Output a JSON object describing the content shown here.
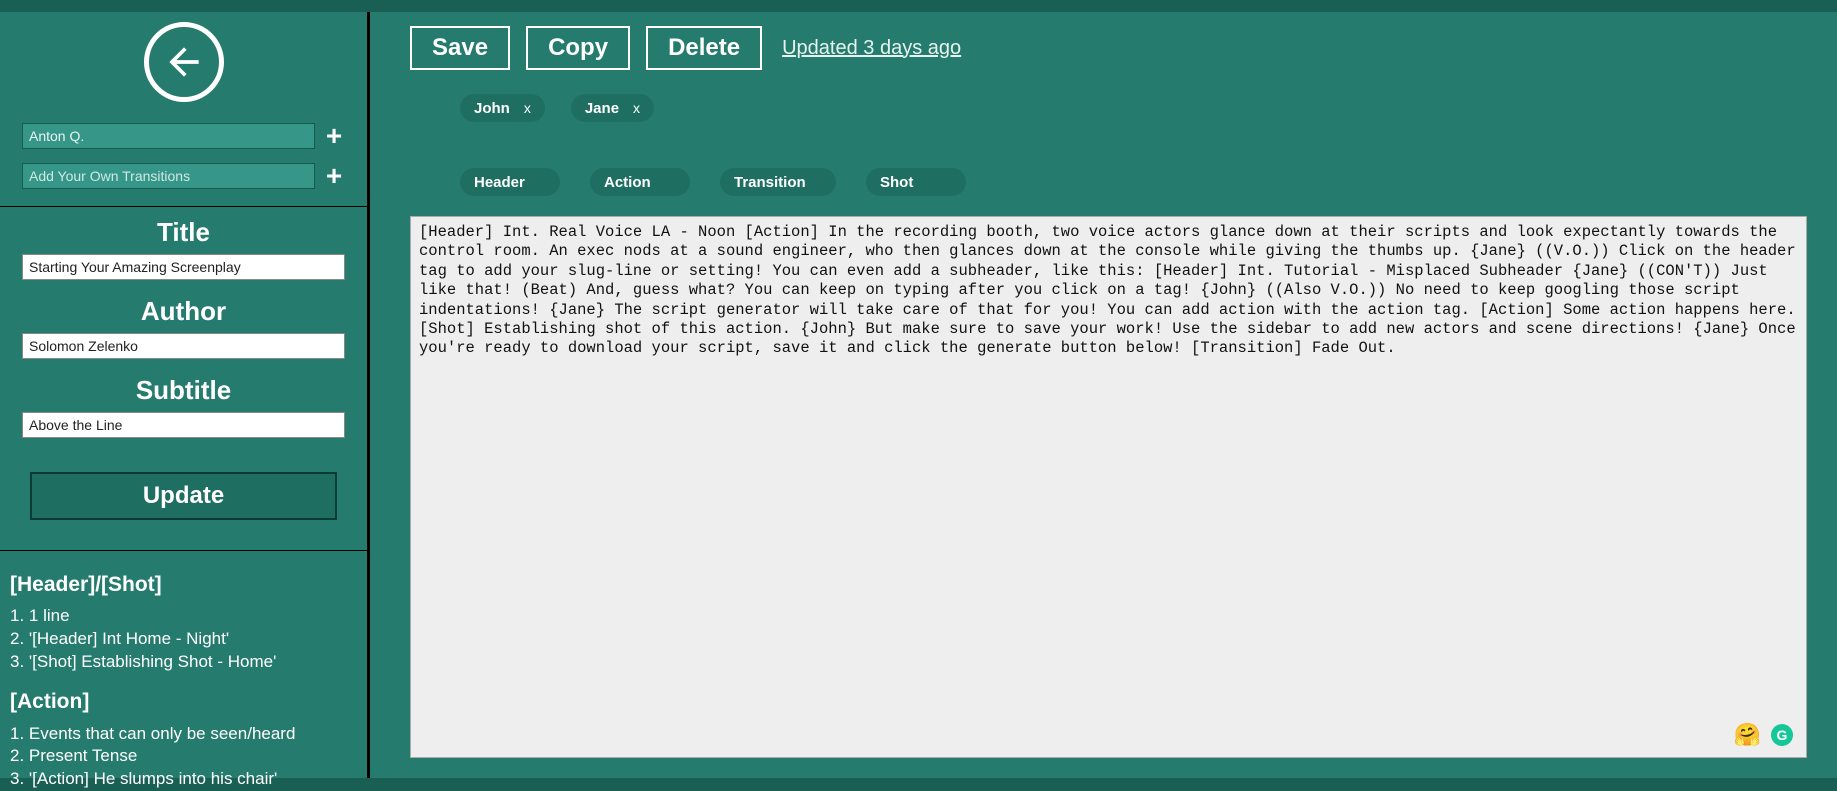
{
  "sidebar": {
    "actor_input_value": "Anton Q.",
    "transition_input_placeholder": "Add Your Own Transitions",
    "title_label": "Title",
    "title_value": "Starting Your Amazing Screenplay",
    "author_label": "Author",
    "author_value": "Solomon Zelenko",
    "subtitle_label": "Subtitle",
    "subtitle_value": "Above the Line",
    "update_label": "Update",
    "help": {
      "header_shot_title": "[Header]/[Shot]",
      "header_shot_items": [
        "1 line",
        "'[Header] Int Home - Night'",
        "'[Shot] Establishing Shot - Home'"
      ],
      "action_title": "[Action]",
      "action_items": [
        "Events that can only be seen/heard",
        "Present Tense",
        "'[Action] He slumps into his chair'"
      ]
    }
  },
  "toolbar": {
    "save": "Save",
    "copy": "Copy",
    "delete": "Delete",
    "updated": "Updated 3 days ago"
  },
  "characters": [
    {
      "name": "John"
    },
    {
      "name": "Jane"
    }
  ],
  "tags": {
    "header": "Header",
    "action": "Action",
    "transition": "Transition",
    "shot": "Shot"
  },
  "editor_text": "[Header] Int. Real Voice LA - Noon [Action] In the recording booth, two voice actors glance down at their scripts and look expectantly towards the control room. An exec nods at a sound engineer, who then glances down at the console while giving the thumbs up. {Jane} ((V.O.)) Click on the header tag to add your slug-line or setting! You can even add a subheader, like this: [Header] Int. Tutorial - Misplaced Subheader {Jane} ((CON'T)) Just like that! (Beat) And, guess what? You can keep on typing after you click on a tag! {John} ((Also V.O.)) No need to keep googling those script indentations! {Jane} The script generator will take care of that for you! You can add action with the action tag. [Action] Some action happens here. [Shot] Establishing shot of this action. {John} But make sure to save your work! Use the sidebar to add new actors and scene directions! {Jane} Once you're ready to download your script, save it and click the generate button below! [Transition] Fade Out."
}
